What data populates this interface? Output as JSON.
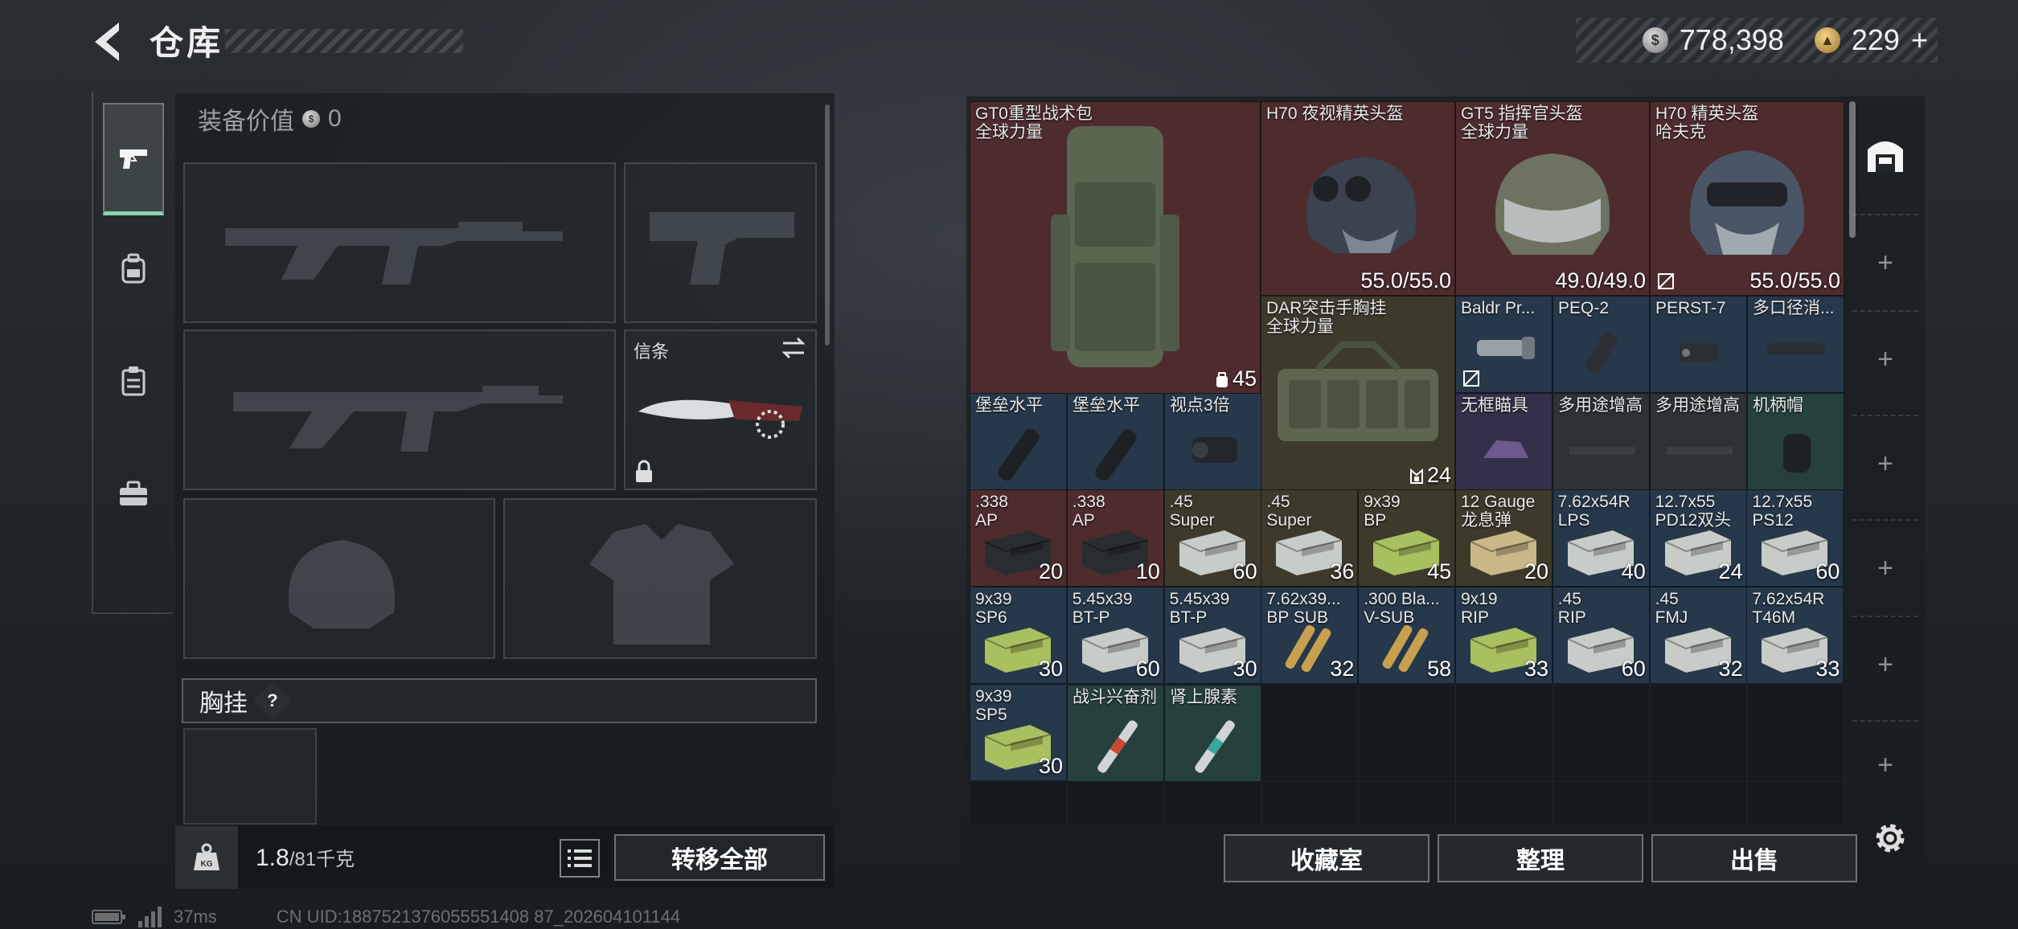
{
  "header": {
    "title": "仓库",
    "currency_silver": "778,398",
    "currency_gold": "229",
    "add_label": "+"
  },
  "nav": {
    "items": [
      "pistol-icon",
      "backpack-icon",
      "clipboard-icon",
      "toolbox-icon"
    ]
  },
  "loadout": {
    "equip_value_label": "装备价值",
    "equip_value": "0",
    "melee_label": "信条",
    "chest_rig_label": "胸挂",
    "help_label": "?",
    "weight": "1.8",
    "weight_max": "/81千克",
    "kg_badge": "KG",
    "transfer_all": "转移全部"
  },
  "stash": {
    "items": [
      {
        "name": "GT0重型战术包",
        "sub": "全球力量",
        "count": "45"
      },
      {
        "name": "H70 夜视精英头盔",
        "sub": "",
        "count": "55.0/55.0"
      },
      {
        "name": "GT5 指挥官头盔",
        "sub": "全球力量",
        "count": "49.0/49.0"
      },
      {
        "name": "H70 精英头盔",
        "sub": "哈夫克",
        "count": "55.0/55.0"
      },
      {
        "name": "DAR突击手胸挂",
        "sub": "全球力量",
        "count": "24"
      },
      {
        "name": "Baldr Pr...",
        "count": ""
      },
      {
        "name": "PEQ-2",
        "count": ""
      },
      {
        "name": "PERST-7",
        "count": ""
      },
      {
        "name": "多口径消...",
        "count": ""
      },
      {
        "name": "堡垒水平",
        "count": ""
      },
      {
        "name": "堡垒水平",
        "count": ""
      },
      {
        "name": "视点3倍",
        "count": ""
      },
      {
        "name": "无框瞄具",
        "count": ""
      },
      {
        "name": "多用途增高",
        "count": ""
      },
      {
        "name": "多用途增高",
        "count": ""
      },
      {
        "name": "机柄帽",
        "count": ""
      },
      {
        "name": ".338",
        "sub": "AP",
        "count": "20"
      },
      {
        "name": ".338",
        "sub": "AP",
        "count": "10"
      },
      {
        "name": ".45",
        "sub": "Super",
        "count": "60"
      },
      {
        "name": ".45",
        "sub": "Super",
        "count": "36"
      },
      {
        "name": "9x39",
        "sub": "BP",
        "count": "45"
      },
      {
        "name": "12 Gauge",
        "sub": "龙息弹",
        "count": "20"
      },
      {
        "name": "7.62x54R",
        "sub": "LPS",
        "count": "40"
      },
      {
        "name": "12.7x55",
        "sub": "PD12双头",
        "count": "24"
      },
      {
        "name": "12.7x55",
        "sub": "PS12",
        "count": "60"
      },
      {
        "name": "9x39",
        "sub": "SP6",
        "count": "30"
      },
      {
        "name": "5.45x39",
        "sub": "BT-P",
        "count": "60"
      },
      {
        "name": "5.45x39",
        "sub": "BT-P",
        "count": "30"
      },
      {
        "name": "7.62x39...",
        "sub": "BP SUB",
        "count": "32"
      },
      {
        "name": ".300 Bla...",
        "sub": "V-SUB",
        "count": "58"
      },
      {
        "name": "9x19",
        "sub": "RIP",
        "count": "33"
      },
      {
        "name": ".45",
        "sub": "RIP",
        "count": "60"
      },
      {
        "name": ".45",
        "sub": "FMJ",
        "count": "32"
      },
      {
        "name": "7.62x54R",
        "sub": "T46M",
        "count": "33"
      },
      {
        "name": "9x39",
        "sub": "SP5",
        "count": "30"
      },
      {
        "name": "战斗兴奋剂",
        "count": ""
      },
      {
        "name": "肾上腺素",
        "count": ""
      }
    ]
  },
  "footer": {
    "vault": "收藏室",
    "sort": "整理",
    "sell": "出售"
  },
  "status": {
    "ping": "37ms",
    "uid": "CN UID:1887521376055551408 87_202604101144"
  },
  "colors": {
    "accent": "#8fd0b0",
    "red_rarity": "#4e2c2e",
    "blue_rarity": "#26384a",
    "olive_rarity": "#3d3a2c"
  }
}
